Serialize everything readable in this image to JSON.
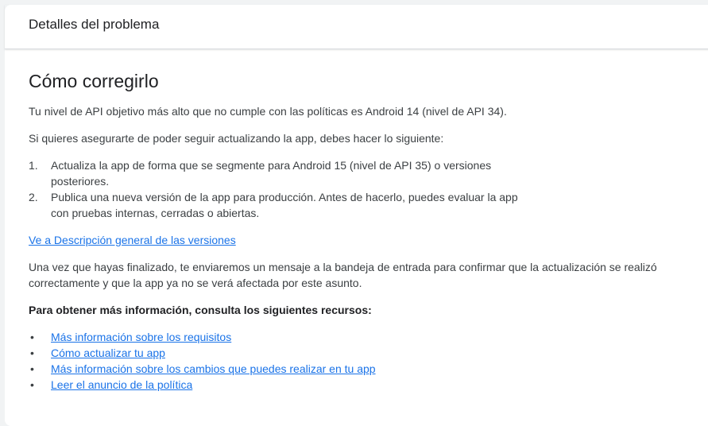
{
  "panel": {
    "title": "Detalles del problema"
  },
  "content": {
    "heading": "Cómo corregirlo",
    "paragraph1": "Tu nivel de API objetivo más alto que no cumple con las políticas es Android 14 (nivel de API 34).",
    "paragraph2": "Si quieres asegurarte de poder seguir actualizando la app, debes hacer lo siguiente:",
    "steps": [
      {
        "number": "1.",
        "text": "Actualiza la app de forma que se segmente para Android 15 (nivel de API 35) o versiones posteriores."
      },
      {
        "number": "2.",
        "text": "Publica una nueva versión de la app para producción. Antes de hacerlo, puedes evaluar la app con pruebas internas, cerradas o abiertas."
      }
    ],
    "overview_link": "Ve a Descripción general de las versiones",
    "paragraph3": "Una vez que hayas finalizado, te enviaremos un mensaje a la bandeja de entrada para confirmar que la actualización se realizó correctamente y que la app ya no se verá afectada por este asunto.",
    "more_info_label": "Para obtener más información, consulta los siguientes recursos:",
    "resources": [
      {
        "bullet": "•",
        "label": "Más información sobre los requisitos"
      },
      {
        "bullet": "•",
        "label": "Cómo actualizar tu app"
      },
      {
        "bullet": "•",
        "label": "Más información sobre los cambios que puedes realizar en tu app"
      },
      {
        "bullet": "•",
        "label": "Leer el anuncio de la política"
      }
    ]
  },
  "colors": {
    "link": "#1a73e8",
    "text": "#3c4043",
    "heading": "#202124",
    "divider": "#dadce0"
  }
}
